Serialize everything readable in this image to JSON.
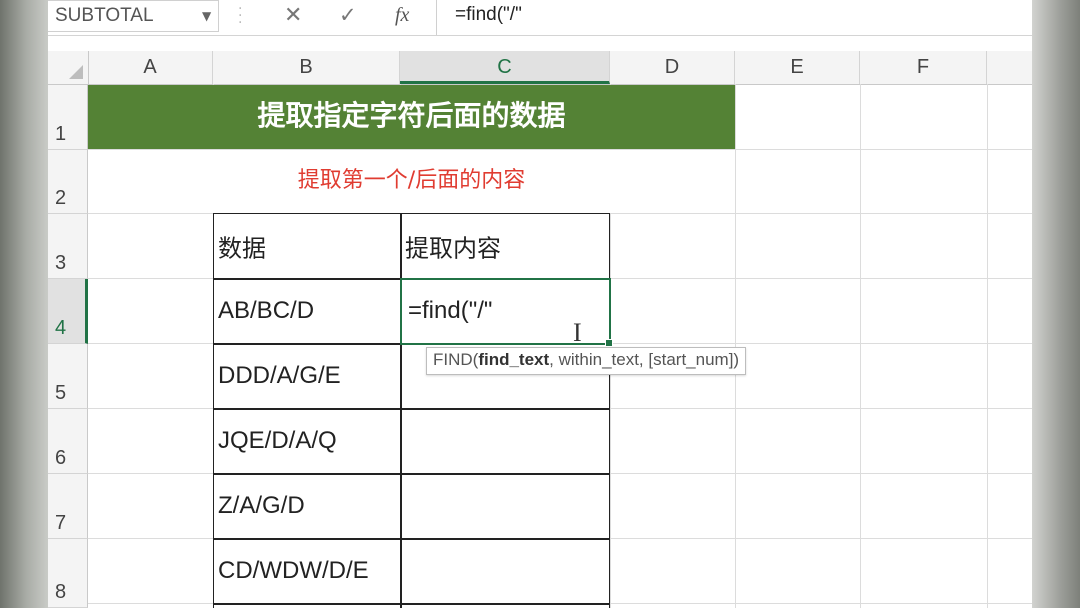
{
  "formula_bar": {
    "name_box": "SUBTOTAL",
    "dropdown_glyph": "▼",
    "separator_glyph": "⋮",
    "cancel_glyph": "✕",
    "enter_glyph": "✓",
    "fx_label": "fx",
    "formula": "=find(\"/\""
  },
  "columns": [
    "A",
    "B",
    "C",
    "D",
    "E",
    "F"
  ],
  "selected_column": "C",
  "rows": [
    "1",
    "2",
    "3",
    "4",
    "5",
    "6",
    "7",
    "8"
  ],
  "selected_row": "4",
  "sheet": {
    "title": "提取指定字符后面的数据",
    "subtitle": "提取第一个/后面的内容",
    "headers": {
      "data": "数据",
      "extract": "提取内容"
    },
    "data_values": [
      "AB/BC/D",
      "DDD/A/G/E",
      "JQE/D/A/Q",
      "Z/A/G/D",
      "CD/WDW/D/E"
    ],
    "active_cell_text": "=find(\"/\""
  },
  "tooltip": {
    "func": "FIND(",
    "arg_bold": "find_text",
    "rest": ", within_text, [start_num])"
  },
  "colors": {
    "title_fill": "#548235",
    "subtitle_text": "#E03C31",
    "excel_green": "#217346"
  }
}
